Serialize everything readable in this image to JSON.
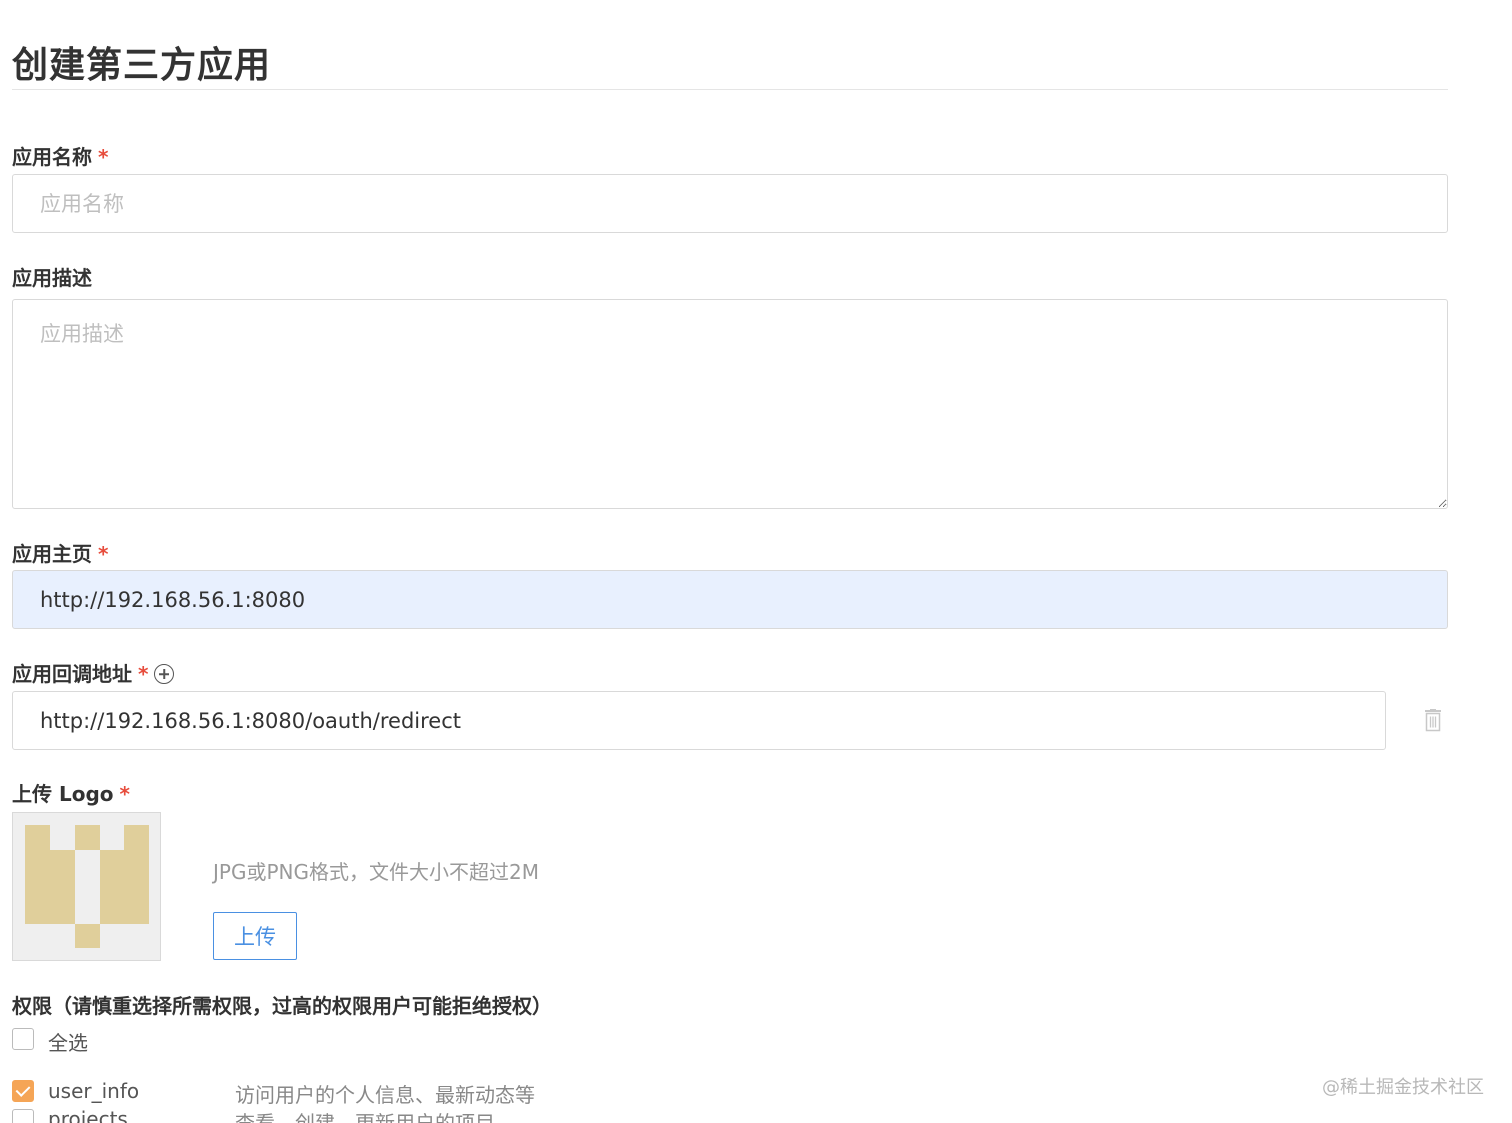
{
  "page": {
    "title": "创建第三方应用"
  },
  "form": {
    "app_name": {
      "label": "应用名称",
      "required_mark": "*",
      "placeholder": "应用名称",
      "value": ""
    },
    "app_desc": {
      "label": "应用描述",
      "placeholder": "应用描述",
      "value": ""
    },
    "homepage": {
      "label": "应用主页",
      "required_mark": "*",
      "value": "http://192.168.56.1:8080"
    },
    "callback": {
      "label": "应用回调地址",
      "required_mark": "*",
      "add_icon": "plus-circle-icon",
      "value": "http://192.168.56.1:8080/oauth/redirect",
      "delete_icon": "trash-icon"
    },
    "logo": {
      "label": "上传 Logo",
      "required_mark": "*",
      "hint": "JPG或PNG格式，文件大小不超过2M",
      "upload_label": "上传"
    },
    "permissions": {
      "label": "权限（请慎重选择所需权限，过高的权限用户可能拒绝授权）",
      "select_all": {
        "label": "全选",
        "checked": false
      },
      "items": [
        {
          "name": "user_info",
          "description": "访问用户的个人信息、最新动态等",
          "checked": true
        },
        {
          "name": "projects",
          "description": "查看、创建、更新用户的项目",
          "checked": false
        }
      ]
    }
  },
  "watermark": "@稀土掘金技术社区",
  "colors": {
    "required": "#e74c3c",
    "upload_button": "#4a90e2",
    "checkbox_checked": "#f5a556",
    "autofill_bg": "#e8f0fe",
    "logo_tile": "#e0cf9b"
  }
}
